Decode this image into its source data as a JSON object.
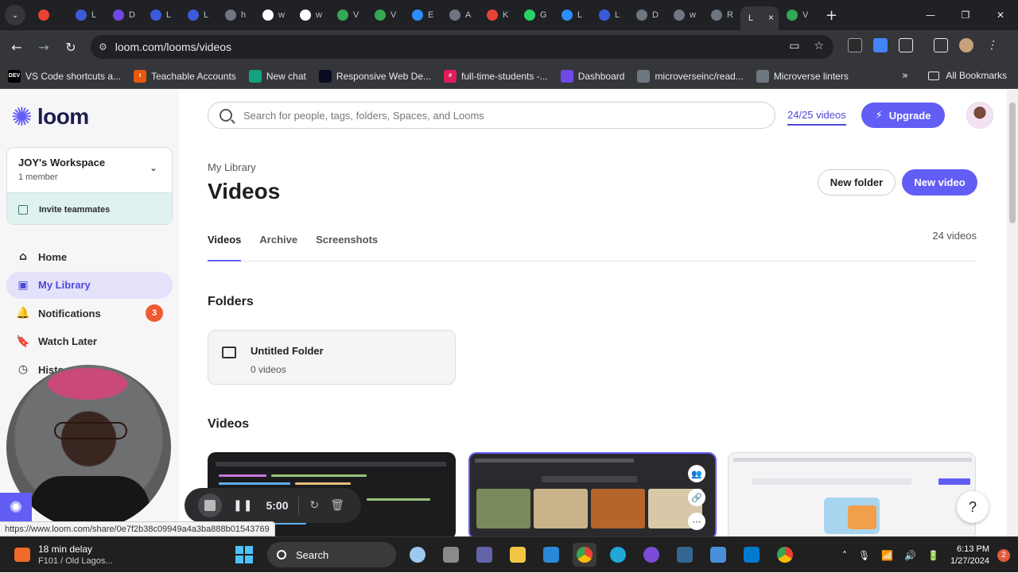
{
  "browser": {
    "tabs": [
      {
        "label": "",
        "color": "#e94235"
      },
      {
        "label": "L",
        "color": "#3b5bdb"
      },
      {
        "label": "D",
        "color": "#7048e8"
      },
      {
        "label": "L",
        "color": "#3b5bdb"
      },
      {
        "label": "L",
        "color": "#3b5bdb"
      },
      {
        "label": "h",
        "color": "#6e7681"
      },
      {
        "label": "w",
        "color": "#ffffff"
      },
      {
        "label": "w",
        "color": "#ffffff"
      },
      {
        "label": "V",
        "color": "#34a853"
      },
      {
        "label": "V",
        "color": "#34a853"
      },
      {
        "label": "E",
        "color": "#2d8cff"
      },
      {
        "label": "A",
        "color": "#6e7681"
      },
      {
        "label": "K",
        "color": "#e94235"
      },
      {
        "label": "G",
        "color": "#25d366"
      },
      {
        "label": "L",
        "color": "#2d8cff"
      },
      {
        "label": "L",
        "color": "#3b5bdb"
      },
      {
        "label": "D",
        "color": "#6e7681"
      },
      {
        "label": "w",
        "color": "#6e7681"
      },
      {
        "label": "R",
        "color": "#6e7681"
      }
    ],
    "active_tab": {
      "label": "L",
      "close": "×"
    },
    "after_tab": {
      "label": "V",
      "color": "#34a853"
    },
    "newtab": "+",
    "window_controls": {
      "minimize": "—",
      "maximize": "❐",
      "close": "✕"
    },
    "url": "loom.com/looms/videos",
    "bookmarks": [
      {
        "label": "VS Code shortcuts a...",
        "icon": "DEV",
        "color": "#000000"
      },
      {
        "label": "Teachable Accounts",
        "icon": "t",
        "color": "#e8590c"
      },
      {
        "label": "New chat",
        "icon": "",
        "color": "#10a37f"
      },
      {
        "label": "Responsive Web De...",
        "icon": "",
        "color": "#0a0a23"
      },
      {
        "label": "full-time-students -...",
        "icon": "#",
        "color": "#e01e5a"
      },
      {
        "label": "Dashboard",
        "icon": "",
        "color": "#7048e8"
      },
      {
        "label": "microverseinc/read...",
        "icon": "",
        "color": "#6e7681"
      },
      {
        "label": "Microverse linters",
        "icon": "",
        "color": "#6e7681"
      }
    ],
    "bookmarks_more": "»",
    "all_bookmarks": "All Bookmarks"
  },
  "sidebar": {
    "logo_text": "loom",
    "workspace": {
      "name": "JOY's Workspace",
      "members": "1 member",
      "invite": "Invite teammates"
    },
    "nav": [
      {
        "label": "Home",
        "icon": "home-icon",
        "glyph": "⌂",
        "active": false,
        "badge": ""
      },
      {
        "label": "My Library",
        "icon": "library-icon",
        "glyph": "▣",
        "active": true,
        "badge": ""
      },
      {
        "label": "Notifications",
        "icon": "bell-icon",
        "glyph": "🔔",
        "active": false,
        "badge": "3"
      },
      {
        "label": "Watch Later",
        "icon": "bookmark-icon",
        "glyph": "🔖",
        "active": false,
        "badge": ""
      },
      {
        "label": "Histo",
        "icon": "clock-icon",
        "glyph": "◷",
        "active": false,
        "badge": ""
      }
    ]
  },
  "header": {
    "search_placeholder": "Search for people, tags, folders, Spaces, and Looms",
    "quota": "24/25 videos",
    "upgrade_label": "Upgrade"
  },
  "library": {
    "breadcrumb": "My Library",
    "title": "Videos",
    "new_folder": "New folder",
    "new_video": "New video",
    "tabs": [
      {
        "label": "Videos",
        "active": true
      },
      {
        "label": "Archive",
        "active": false
      },
      {
        "label": "Screenshots",
        "active": false
      }
    ],
    "count": "24 videos",
    "folders_heading": "Folders",
    "folders": [
      {
        "name": "Untitled Folder",
        "count": "0 videos"
      }
    ],
    "videos_heading": "Videos",
    "help": "?"
  },
  "recorder": {
    "timer": "5:00",
    "pause_glyph": "❚❚",
    "restart_glyph": "↻",
    "delete_glyph": "🗑"
  },
  "status_url": "https://www.loom.com/share/0e7f2b38c09949a4a3ba888b01543769",
  "taskbar": {
    "weather_line1": "18 min delay",
    "weather_line2": "F101 / Old Lagos...",
    "search_label": "Search",
    "time": "6:13 PM",
    "date": "1/27/2024",
    "notifications": "2"
  }
}
